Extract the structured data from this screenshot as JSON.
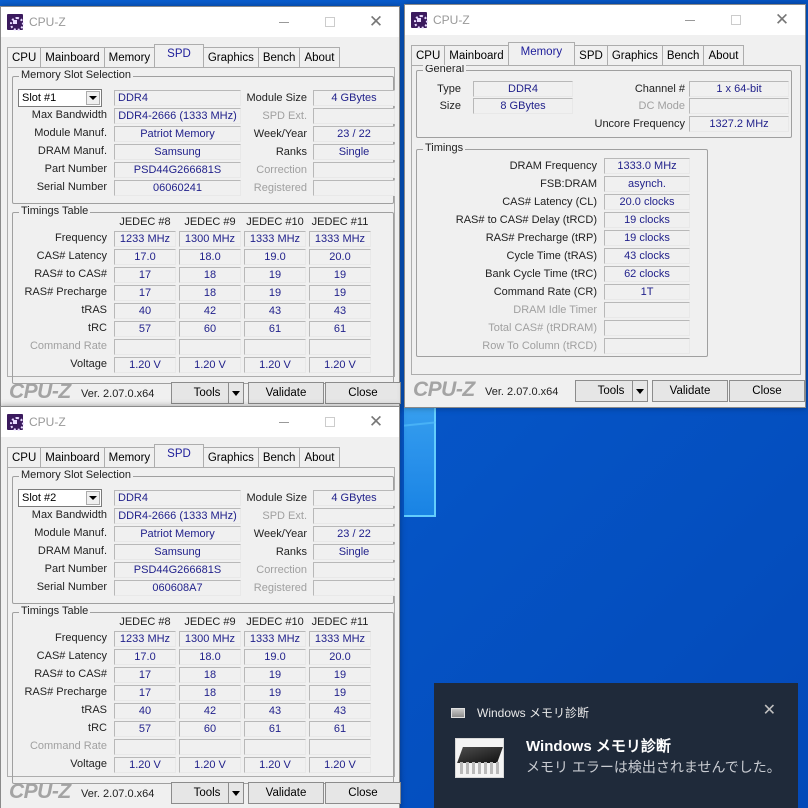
{
  "desktop": {
    "background_color": "#0658c9"
  },
  "windows": [
    {
      "id": "spd1",
      "title": "CPU-Z",
      "tabs": [
        "CPU",
        "Mainboard",
        "Memory",
        "SPD",
        "Graphics",
        "Bench",
        "About"
      ],
      "active_tab": "SPD",
      "slot_group_label": "Memory Slot Selection",
      "slot_selected": "Slot #1",
      "memory_type": "DDR4",
      "fields": {
        "max_bandwidth_label": "Max Bandwidth",
        "max_bandwidth": "DDR4-2666 (1333 MHz)",
        "module_manuf_label": "Module Manuf.",
        "module_manuf": "Patriot Memory",
        "dram_manuf_label": "DRAM Manuf.",
        "dram_manuf": "Samsung",
        "part_number_label": "Part Number",
        "part_number": "PSD44G266681S",
        "serial_number_label": "Serial Number",
        "serial_number": "06060241",
        "module_size_label": "Module Size",
        "module_size": "4 GBytes",
        "spd_ext_label": "SPD Ext.",
        "spd_ext": "",
        "week_year_label": "Week/Year",
        "week_year": "23 / 22",
        "ranks_label": "Ranks",
        "ranks": "Single",
        "correction_label": "Correction",
        "correction": "",
        "registered_label": "Registered",
        "registered": ""
      },
      "timings_group_label": "Timings Table",
      "timings_columns": [
        "JEDEC #8",
        "JEDEC #9",
        "JEDEC #10",
        "JEDEC #11"
      ],
      "timings_rows": [
        {
          "label": "Frequency",
          "values": [
            "1233 MHz",
            "1300 MHz",
            "1333 MHz",
            "1333 MHz"
          ],
          "dim": false
        },
        {
          "label": "CAS# Latency",
          "values": [
            "17.0",
            "18.0",
            "19.0",
            "20.0"
          ],
          "dim": false
        },
        {
          "label": "RAS# to CAS#",
          "values": [
            "17",
            "18",
            "19",
            "19"
          ],
          "dim": false
        },
        {
          "label": "RAS# Precharge",
          "values": [
            "17",
            "18",
            "19",
            "19"
          ],
          "dim": false
        },
        {
          "label": "tRAS",
          "values": [
            "40",
            "42",
            "43",
            "43"
          ],
          "dim": false
        },
        {
          "label": "tRC",
          "values": [
            "57",
            "60",
            "61",
            "61"
          ],
          "dim": false
        },
        {
          "label": "Command Rate",
          "values": [
            "",
            "",
            "",
            ""
          ],
          "dim": true
        },
        {
          "label": "Voltage",
          "values": [
            "1.20 V",
            "1.20 V",
            "1.20 V",
            "1.20 V"
          ],
          "dim": false
        }
      ],
      "footer": {
        "brand": "CPU-Z",
        "version": "Ver. 2.07.0.x64",
        "tools": "Tools",
        "validate": "Validate",
        "close": "Close"
      }
    },
    {
      "id": "spd2",
      "title": "CPU-Z",
      "tabs": [
        "CPU",
        "Mainboard",
        "Memory",
        "SPD",
        "Graphics",
        "Bench",
        "About"
      ],
      "active_tab": "SPD",
      "slot_group_label": "Memory Slot Selection",
      "slot_selected": "Slot #2",
      "memory_type": "DDR4",
      "fields": {
        "max_bandwidth_label": "Max Bandwidth",
        "max_bandwidth": "DDR4-2666 (1333 MHz)",
        "module_manuf_label": "Module Manuf.",
        "module_manuf": "Patriot Memory",
        "dram_manuf_label": "DRAM Manuf.",
        "dram_manuf": "Samsung",
        "part_number_label": "Part Number",
        "part_number": "PSD44G266681S",
        "serial_number_label": "Serial Number",
        "serial_number": "060608A7",
        "module_size_label": "Module Size",
        "module_size": "4 GBytes",
        "spd_ext_label": "SPD Ext.",
        "spd_ext": "",
        "week_year_label": "Week/Year",
        "week_year": "23 / 22",
        "ranks_label": "Ranks",
        "ranks": "Single",
        "correction_label": "Correction",
        "correction": "",
        "registered_label": "Registered",
        "registered": ""
      },
      "timings_group_label": "Timings Table",
      "timings_columns": [
        "JEDEC #8",
        "JEDEC #9",
        "JEDEC #10",
        "JEDEC #11"
      ],
      "timings_rows": [
        {
          "label": "Frequency",
          "values": [
            "1233 MHz",
            "1300 MHz",
            "1333 MHz",
            "1333 MHz"
          ],
          "dim": false
        },
        {
          "label": "CAS# Latency",
          "values": [
            "17.0",
            "18.0",
            "19.0",
            "20.0"
          ],
          "dim": false
        },
        {
          "label": "RAS# to CAS#",
          "values": [
            "17",
            "18",
            "19",
            "19"
          ],
          "dim": false
        },
        {
          "label": "RAS# Precharge",
          "values": [
            "17",
            "18",
            "19",
            "19"
          ],
          "dim": false
        },
        {
          "label": "tRAS",
          "values": [
            "40",
            "42",
            "43",
            "43"
          ],
          "dim": false
        },
        {
          "label": "tRC",
          "values": [
            "57",
            "60",
            "61",
            "61"
          ],
          "dim": false
        },
        {
          "label": "Command Rate",
          "values": [
            "",
            "",
            "",
            ""
          ],
          "dim": true
        },
        {
          "label": "Voltage",
          "values": [
            "1.20 V",
            "1.20 V",
            "1.20 V",
            "1.20 V"
          ],
          "dim": false
        }
      ],
      "footer": {
        "brand": "CPU-Z",
        "version": "Ver. 2.07.0.x64",
        "tools": "Tools",
        "validate": "Validate",
        "close": "Close"
      }
    }
  ],
  "memory_window": {
    "title": "CPU-Z",
    "tabs": [
      "CPU",
      "Mainboard",
      "Memory",
      "SPD",
      "Graphics",
      "Bench",
      "About"
    ],
    "active_tab": "Memory",
    "general": {
      "label": "General",
      "type_label": "Type",
      "type": "DDR4",
      "size_label": "Size",
      "size": "8 GBytes",
      "channel_label": "Channel #",
      "channel": "1 x 64-bit",
      "dc_mode_label": "DC Mode",
      "dc_mode": "",
      "uncore_label": "Uncore Frequency",
      "uncore": "1327.2 MHz"
    },
    "timings": {
      "label": "Timings",
      "rows": [
        {
          "label": "DRAM Frequency",
          "value": "1333.0 MHz",
          "dim": false
        },
        {
          "label": "FSB:DRAM",
          "value": "asynch.",
          "dim": false
        },
        {
          "label": "CAS# Latency (CL)",
          "value": "20.0 clocks",
          "dim": false
        },
        {
          "label": "RAS# to CAS# Delay (tRCD)",
          "value": "19 clocks",
          "dim": false
        },
        {
          "label": "RAS# Precharge (tRP)",
          "value": "19 clocks",
          "dim": false
        },
        {
          "label": "Cycle Time (tRAS)",
          "value": "43 clocks",
          "dim": false
        },
        {
          "label": "Bank Cycle Time (tRC)",
          "value": "62 clocks",
          "dim": false
        },
        {
          "label": "Command Rate (CR)",
          "value": "1T",
          "dim": false
        },
        {
          "label": "DRAM Idle Timer",
          "value": "",
          "dim": true
        },
        {
          "label": "Total CAS# (tRDRAM)",
          "value": "",
          "dim": true
        },
        {
          "label": "Row To Column (tRCD)",
          "value": "",
          "dim": true
        }
      ]
    },
    "footer": {
      "brand": "CPU-Z",
      "version": "Ver. 2.07.0.x64",
      "tools": "Tools",
      "validate": "Validate",
      "close": "Close"
    }
  },
  "toast": {
    "app_name": "Windows メモリ診断",
    "title": "Windows メモリ診断",
    "body": "メモリ エラーは検出されませんでした。",
    "icon": "memory-chip-icon",
    "close_icon": "close-icon"
  }
}
